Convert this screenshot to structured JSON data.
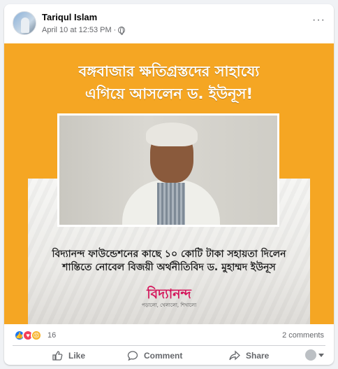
{
  "post": {
    "author": "Tariqul Islam",
    "timestamp": "April 10 at 12:53 PM",
    "separator": "·",
    "privacy_icon": "globe-icon",
    "more_label": "···"
  },
  "image": {
    "headline_line1": "বঙ্গবাজার ক্ষতিগ্রস্তদের সাহায্যে",
    "headline_line2": "এগিয়ে আসলেন ড. ইউনূস!",
    "sub_line1": "বিদ্যানন্দ ফাউন্ডেশনের কাছে ১০ কোটি টাকা সহায়তা দিলেন",
    "sub_line2": "শান্তিতে নোবেল বিজয়ী অর্থনীতিবিদ ড. মুহাম্মদ ইউনূস",
    "logo_text": "বিদ্যানন্দ",
    "logo_tagline": "পড়ালো, খেলালো, শিখালো",
    "bg_color": "#f5a623"
  },
  "stats": {
    "reactions": [
      "like",
      "love",
      "angry"
    ],
    "reaction_count": "16",
    "comments": "2 comments"
  },
  "actions": {
    "like": "Like",
    "comment": "Comment",
    "share": "Share"
  },
  "colors": {
    "accent": "#1877f2",
    "muted": "#65676b"
  }
}
